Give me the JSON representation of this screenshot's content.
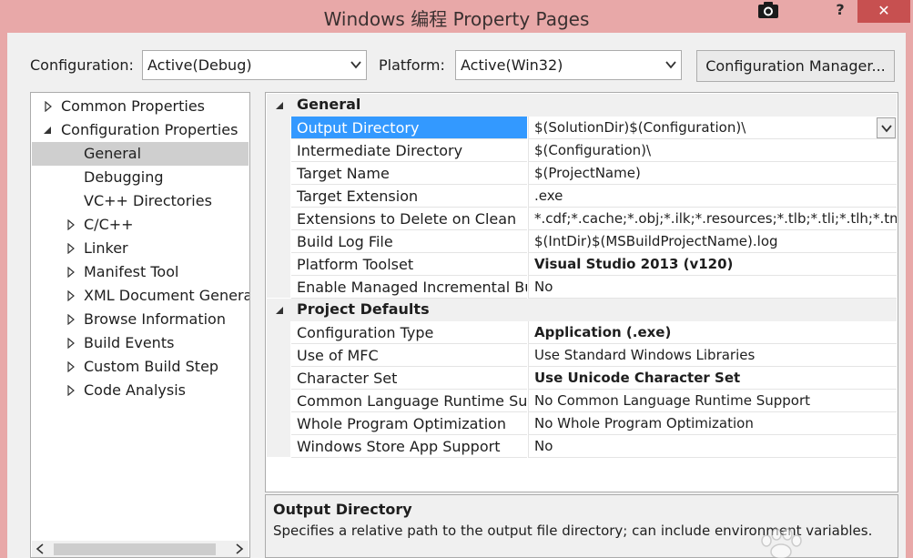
{
  "window": {
    "title": "Windows 编程 Property Pages",
    "help_label": "?",
    "close_label": "✕"
  },
  "toolbar": {
    "configuration_label": "Configuration:",
    "configuration_value": "Active(Debug)",
    "platform_label": "Platform:",
    "platform_value": "Active(Win32)",
    "config_manager_label": "Configuration Manager..."
  },
  "tree": [
    {
      "label": "Common Properties",
      "expander": "collapsed"
    },
    {
      "label": "Configuration Properties",
      "expander": "expanded"
    },
    {
      "label": "General",
      "expander": "none",
      "selected": true
    },
    {
      "label": "Debugging",
      "expander": "none"
    },
    {
      "label": "VC++ Directories",
      "expander": "none"
    },
    {
      "label": "C/C++",
      "expander": "collapsed"
    },
    {
      "label": "Linker",
      "expander": "collapsed"
    },
    {
      "label": "Manifest Tool",
      "expander": "collapsed"
    },
    {
      "label": "XML Document Generat",
      "expander": "collapsed"
    },
    {
      "label": "Browse Information",
      "expander": "collapsed"
    },
    {
      "label": "Build Events",
      "expander": "collapsed"
    },
    {
      "label": "Custom Build Step",
      "expander": "collapsed"
    },
    {
      "label": "Code Analysis",
      "expander": "collapsed"
    }
  ],
  "properties": {
    "general": {
      "label": "General",
      "rows": [
        {
          "name": "Output Directory",
          "value": "$(SolutionDir)$(Configuration)\\",
          "selected": true
        },
        {
          "name": "Intermediate Directory",
          "value": "$(Configuration)\\"
        },
        {
          "name": "Target Name",
          "value": "$(ProjectName)"
        },
        {
          "name": "Target Extension",
          "value": ".exe"
        },
        {
          "name": "Extensions to Delete on Clean",
          "value": "*.cdf;*.cache;*.obj;*.ilk;*.resources;*.tlb;*.tli;*.tlh;*.tmp;*"
        },
        {
          "name": "Build Log File",
          "value": "$(IntDir)$(MSBuildProjectName).log"
        },
        {
          "name": "Platform Toolset",
          "value": "Visual Studio 2013 (v120)",
          "bold": true
        },
        {
          "name": "Enable Managed Incremental Bui",
          "value": "No"
        }
      ]
    },
    "project_defaults": {
      "label": "Project Defaults",
      "rows": [
        {
          "name": "Configuration Type",
          "value": "Application (.exe)",
          "bold": true
        },
        {
          "name": "Use of MFC",
          "value": "Use Standard Windows Libraries"
        },
        {
          "name": "Character Set",
          "value": "Use Unicode Character Set",
          "bold": true
        },
        {
          "name": "Common Language Runtime Supp",
          "value": "No Common Language Runtime Support"
        },
        {
          "name": "Whole Program Optimization",
          "value": "No Whole Program Optimization"
        },
        {
          "name": "Windows Store App Support",
          "value": "No"
        }
      ]
    }
  },
  "description": {
    "title": "Output Directory",
    "text": "Specifies a relative path to the output file directory; can include environment variables."
  },
  "colors": {
    "title_bar": "#e8a8a8",
    "close_button": "#c75050",
    "selection": "#3399ff",
    "tree_selection": "#cfcfcf"
  }
}
